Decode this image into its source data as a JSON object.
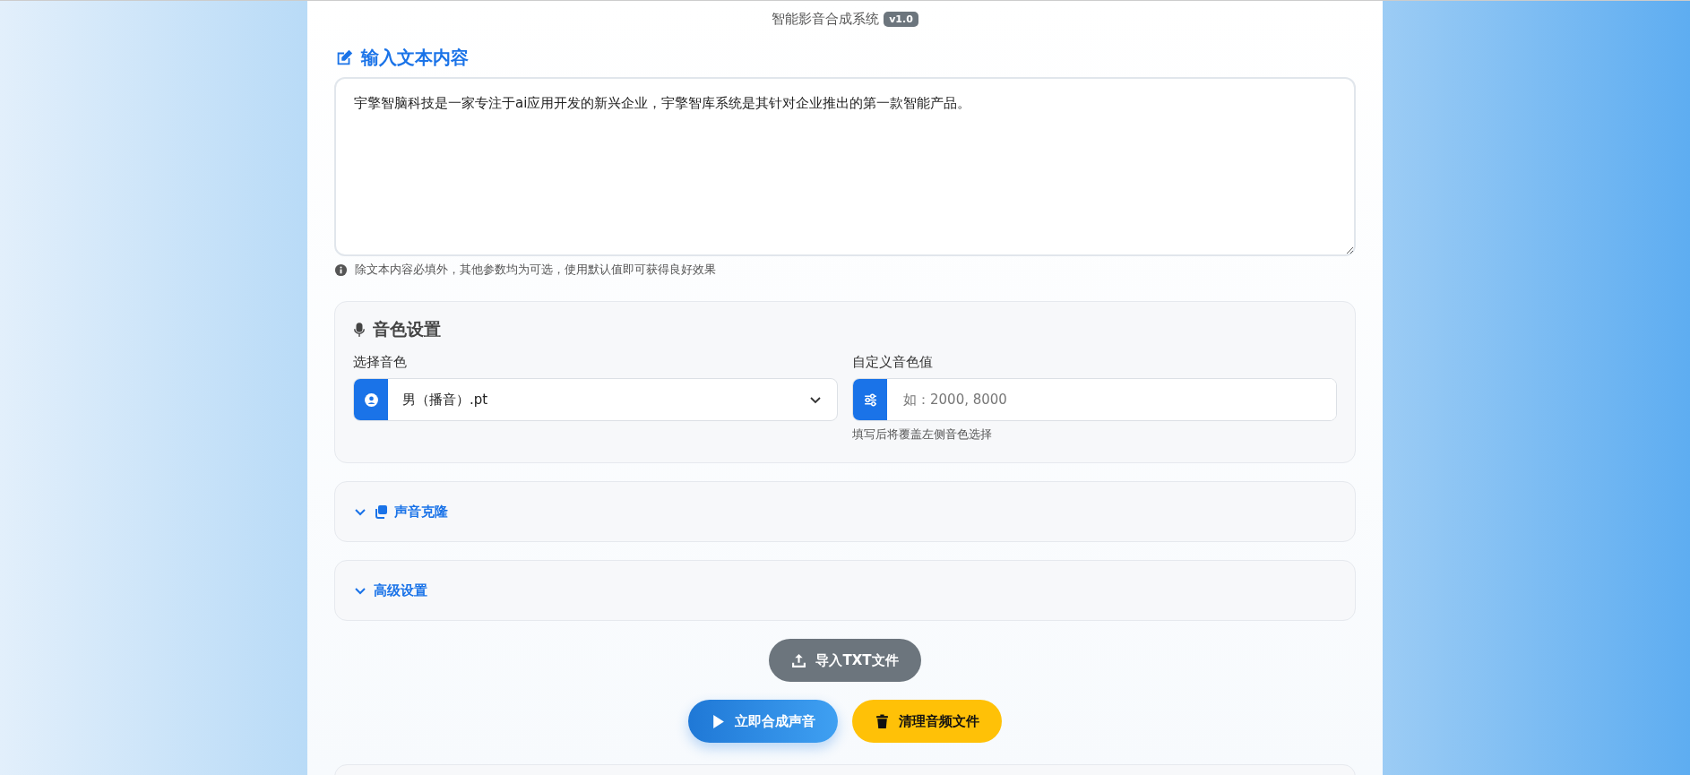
{
  "header": {
    "title": "智能影音合成系统",
    "version": "v1.0"
  },
  "text_input": {
    "heading": "输入文本内容",
    "value": "宇擎智脑科技是一家专注于ai应用开发的新兴企业，宇擎智库系统是其针对企业推出的第一款智能产品。",
    "hint": "除文本内容必填外，其他参数均为可选，使用默认值即可获得良好效果"
  },
  "voice_settings": {
    "heading": "音色设置",
    "select_label": "选择音色",
    "select_value": "男（播音）.pt",
    "custom_label": "自定义音色值",
    "custom_placeholder": "如：2000, 8000",
    "custom_help": "填写后将覆盖左侧音色选择"
  },
  "sections": [
    {
      "kind": "clone",
      "title": "声音克隆",
      "expanded": false
    },
    {
      "kind": "plain",
      "title": "高级设置",
      "expanded": false
    }
  ],
  "import_button": "导入TXT文件",
  "actions": [
    {
      "kind": "primary",
      "label": "立即合成声音"
    },
    {
      "kind": "warning",
      "label": "清理音频文件"
    }
  ]
}
